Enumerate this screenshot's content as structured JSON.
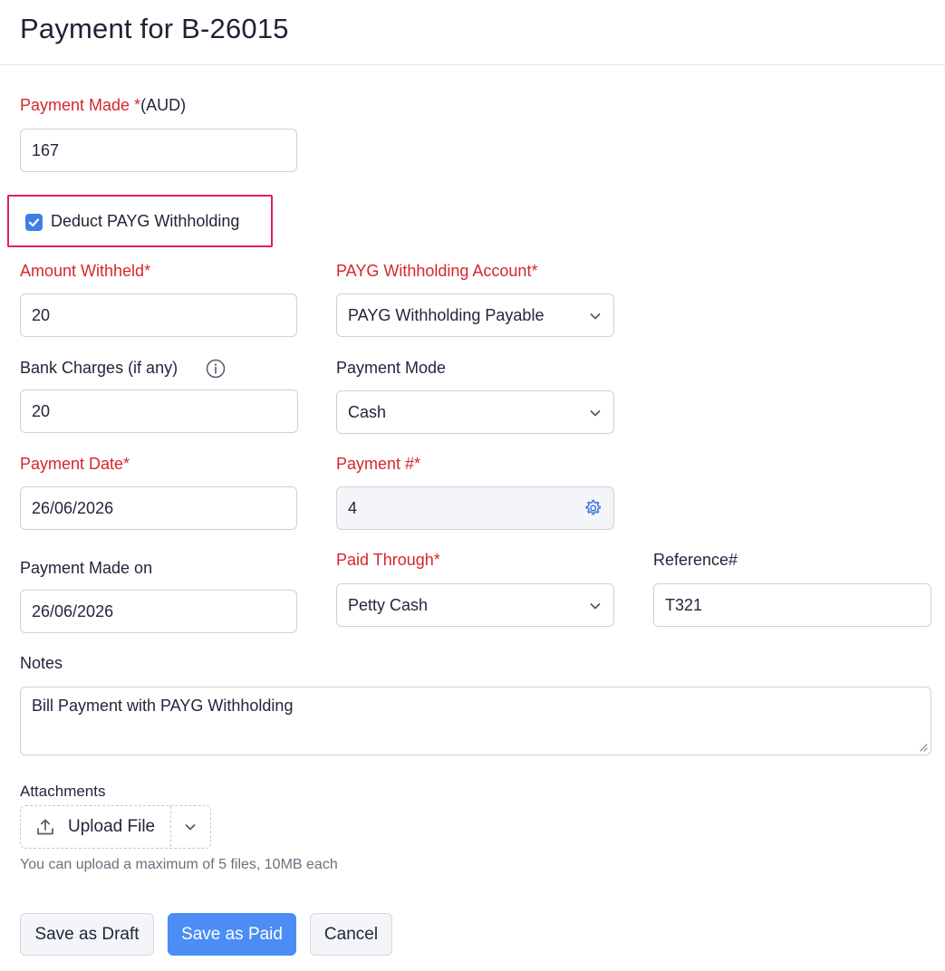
{
  "header": {
    "title": "Payment for B-26015"
  },
  "payment_made": {
    "label": "Payment Made *",
    "currency": "(AUD)",
    "value": "167"
  },
  "deduct_payg": {
    "label": "Deduct PAYG Withholding",
    "checked": true
  },
  "amount_withheld": {
    "label": "Amount Withheld*",
    "value": "20"
  },
  "payg_account": {
    "label": "PAYG Withholding Account*",
    "value": "PAYG Withholding Payable"
  },
  "bank_charges": {
    "label": "Bank Charges (if any)",
    "value": "20"
  },
  "payment_mode": {
    "label": "Payment Mode",
    "value": "Cash"
  },
  "payment_date": {
    "label": "Payment Date*",
    "value": "26/06/2026"
  },
  "payment_number": {
    "label": "Payment #*",
    "value": "4"
  },
  "payment_made_on": {
    "label": "Payment Made on",
    "value": "26/06/2026"
  },
  "paid_through": {
    "label": "Paid Through*",
    "value": "Petty Cash"
  },
  "reference": {
    "label": "Reference#",
    "value": "T321"
  },
  "notes": {
    "label": "Notes",
    "value": "Bill Payment with PAYG Withholding"
  },
  "attachments": {
    "label": "Attachments",
    "upload_label": "Upload File",
    "hint": "You can upload a maximum of 5 files, 10MB each"
  },
  "actions": {
    "save_draft": "Save as Draft",
    "save_paid": "Save as Paid",
    "cancel": "Cancel"
  },
  "colors": {
    "required": "#d6262b",
    "primary": "#4b8df5",
    "highlight": "#e31e5a",
    "checkbox": "#3d7fe6"
  },
  "icons": {
    "checkbox": "check-icon",
    "info": "info-icon",
    "chevron": "chevron-down-icon",
    "gear": "gear-icon",
    "upload": "upload-icon"
  }
}
